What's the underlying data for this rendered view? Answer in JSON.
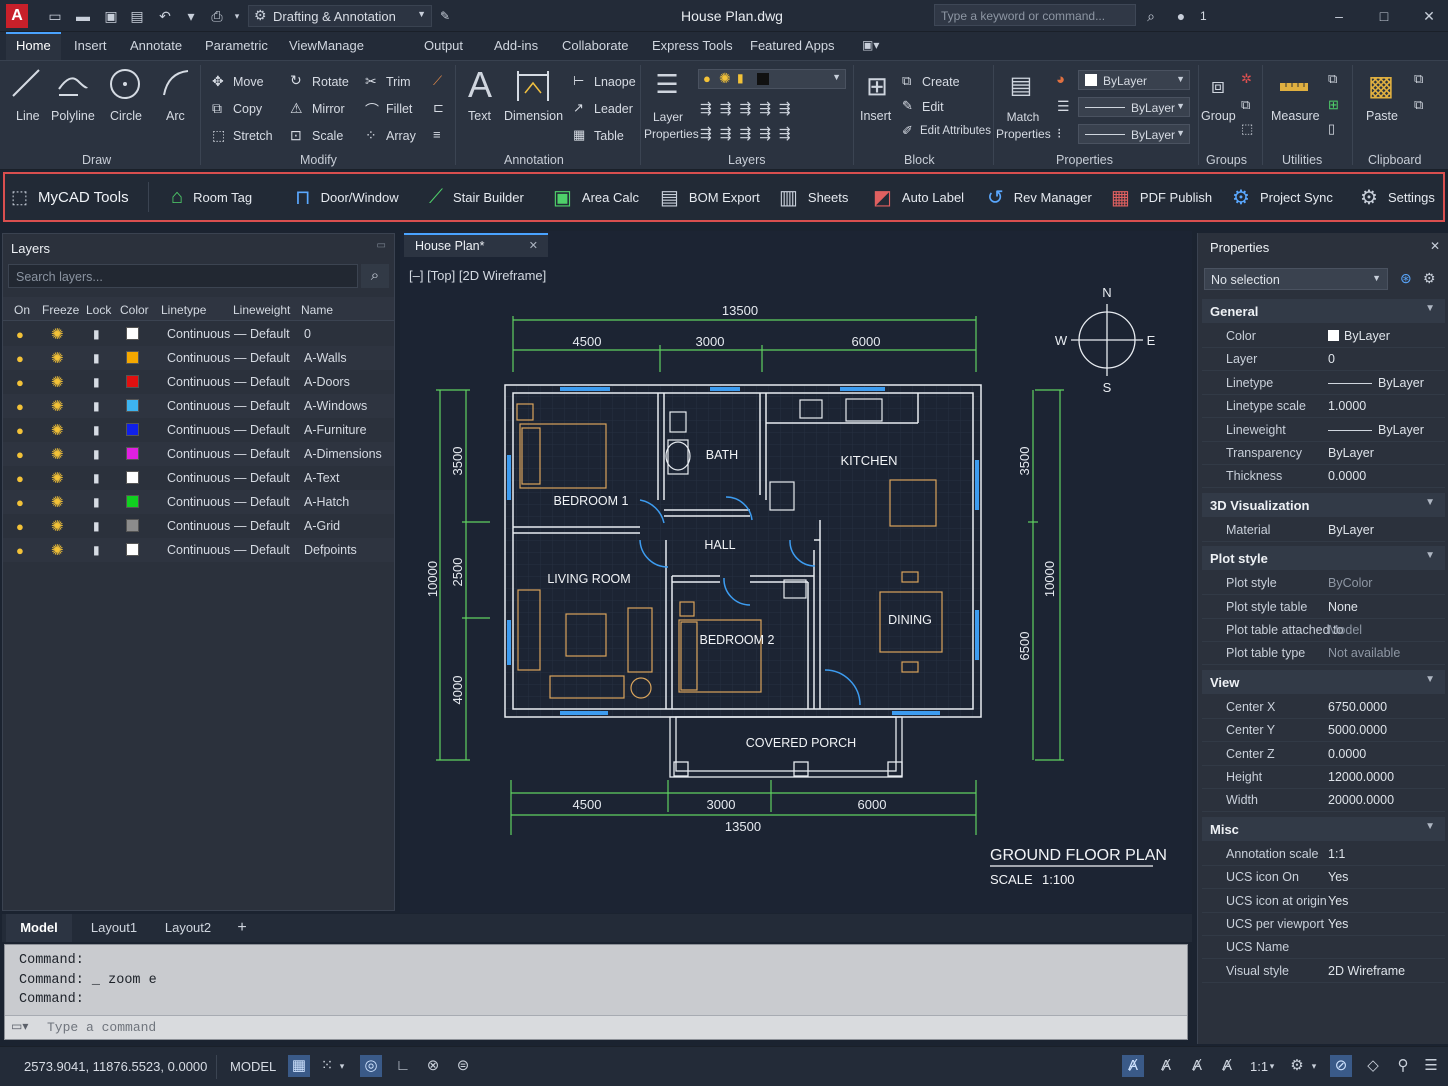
{
  "titlebar": {
    "workspace": "Drafting & Annotation",
    "title": "House Plan.dwg",
    "search_placeholder": "Type a keyword or command...",
    "user_count": "1"
  },
  "ribbon_tabs": [
    "Home",
    "Insert",
    "Annotate",
    "Parametric",
    "View",
    "Manage",
    "Output",
    "Add-ins",
    "Collaborate",
    "Express Tools",
    "Featured Apps"
  ],
  "ribbon": {
    "draw": {
      "line": "Line",
      "polyline": "Polyline",
      "circle": "Circle",
      "arc": "Arc",
      "label": "Draw"
    },
    "modify": {
      "move": "Move",
      "rotate": "Rotate",
      "trim": "Trim",
      "copy": "Copy",
      "mirror": "Mirror",
      "fillet": "Fillet",
      "stretch": "Stretch",
      "scale": "Scale",
      "array": "Array",
      "label": "Modify"
    },
    "annotation": {
      "text": "Text",
      "dimension": "Dimension",
      "linear": "Lnaope",
      "leader": "Leader",
      "table": "Table",
      "label": "Annotation"
    },
    "layers": {
      "layer_properties": "Layer Properties",
      "label": "Layers"
    },
    "block": {
      "insert": "Insert",
      "create": "Create",
      "edit": "Edit",
      "edit_attributes": "Edit Attributes",
      "label": "Block"
    },
    "properties": {
      "match": "Match Properties",
      "color": "ByLayer",
      "linetype": "ByLayer",
      "lineweight": "ByLayer",
      "label": "Properties"
    },
    "groups": {
      "group": "Group",
      "label": "Groups"
    },
    "utilities": {
      "measure": "Measure",
      "label": "Utilities"
    },
    "clipboard": {
      "paste": "Paste",
      "label": "Clipboard"
    }
  },
  "mycad": {
    "title": "MyCAD Tools",
    "tools": [
      "Room Tag",
      "Door/Window",
      "Stair Builder",
      "Area Calc",
      "BOM Export",
      "Sheets",
      "Auto Label",
      "Rev Manager",
      "PDF Publish",
      "Project Sync",
      "Settings"
    ]
  },
  "layers_panel": {
    "title": "Layers",
    "search_placeholder": "Search layers...",
    "columns": [
      "On",
      "Freeze",
      "Lock",
      "Color",
      "Linetype",
      "Lineweight",
      "Name"
    ],
    "rows": [
      {
        "color": "#ffffff",
        "linetype": "Continuous",
        "lineweight": "— Default",
        "name": "0"
      },
      {
        "color": "#f5a800",
        "linetype": "Continuous",
        "lineweight": "— Default",
        "name": "A-Walls"
      },
      {
        "color": "#e01010",
        "linetype": "Continuous",
        "lineweight": "— Default",
        "name": "A-Doors"
      },
      {
        "color": "#3db4f0",
        "linetype": "Continuous",
        "lineweight": "— Default",
        "name": "A-Windows"
      },
      {
        "color": "#1020e8",
        "linetype": "Continuous",
        "lineweight": "— Default",
        "name": "A-Furniture"
      },
      {
        "color": "#e020e0",
        "linetype": "Continuous",
        "lineweight": "— Default",
        "name": "A-Dimensions"
      },
      {
        "color": "#ffffff",
        "linetype": "Continuous",
        "lineweight": "— Default",
        "name": "A-Text"
      },
      {
        "color": "#10d020",
        "linetype": "Continuous",
        "lineweight": "— Default",
        "name": "A-Hatch"
      },
      {
        "color": "#8c8c8c",
        "linetype": "Continuous",
        "lineweight": "— Default",
        "name": "A-Grid"
      },
      {
        "color": "#ffffff",
        "linetype": "Continuous",
        "lineweight": "— Default",
        "name": "Defpoints"
      }
    ]
  },
  "drawing": {
    "tab": "House Plan*",
    "viewport_label": "[–] [Top] [2D Wireframe]",
    "dims_top": {
      "total": "13500",
      "a": "4500",
      "b": "3000",
      "c": "6000"
    },
    "dims_bottom": {
      "total": "13500",
      "a": "4500",
      "b": "3000",
      "c": "6000"
    },
    "dims_left": {
      "total": "10000",
      "a": "3500",
      "b": "2500",
      "c": "4000"
    },
    "dims_right": {
      "total": "10000",
      "a": "3500",
      "b": "6500"
    },
    "rooms": {
      "bedroom1": "BEDROOM 1",
      "bath": "BATH",
      "kitchen": "KITCHEN",
      "hall": "HALL",
      "living": "LIVING ROOM",
      "bedroom2": "BEDROOM 2",
      "dining": "DINING",
      "porch": "COVERED PORCH"
    },
    "compass": {
      "n": "N",
      "s": "S",
      "e": "E",
      "w": "W"
    },
    "plan_title": "GROUND FLOOR PLAN",
    "scale_label": "SCALE",
    "scale_value": "1:100"
  },
  "layout_tabs": [
    "Model",
    "Layout1",
    "Layout2"
  ],
  "command": {
    "history": [
      "Command:",
      "Command: _ zoom e",
      "Command:"
    ],
    "placeholder": "Type a command"
  },
  "properties": {
    "title": "Properties",
    "selection": "No selection",
    "sections": [
      {
        "name": "General",
        "rows": [
          [
            "Color",
            "ByLayer"
          ],
          [
            "Layer",
            "0"
          ],
          [
            "Linetype",
            "ByLayer"
          ],
          [
            "Linetype scale",
            "1.0000"
          ],
          [
            "Lineweight",
            "ByLayer"
          ],
          [
            "Transparency",
            "ByLayer"
          ],
          [
            "Thickness",
            "0.0000"
          ]
        ]
      },
      {
        "name": "3D Visualization",
        "rows": [
          [
            "Material",
            "ByLayer"
          ]
        ]
      },
      {
        "name": "Plot style",
        "rows": [
          [
            "Plot style",
            "ByColor"
          ],
          [
            "Plot style table",
            "None"
          ],
          [
            "Plot table attached to",
            "Model"
          ],
          [
            "Plot table type",
            "Not available"
          ]
        ]
      },
      {
        "name": "View",
        "rows": [
          [
            "Center X",
            "6750.0000"
          ],
          [
            "Center Y",
            "5000.0000"
          ],
          [
            "Center Z",
            "0.0000"
          ],
          [
            "Height",
            "12000.0000"
          ],
          [
            "Width",
            "20000.0000"
          ]
        ]
      },
      {
        "name": "Misc",
        "rows": [
          [
            "Annotation scale",
            "1:1"
          ],
          [
            "UCS icon On",
            "Yes"
          ],
          [
            "UCS icon at origin",
            "Yes"
          ],
          [
            "UCS per viewport",
            "Yes"
          ],
          [
            "UCS Name",
            ""
          ],
          [
            "Visual style",
            "2D Wireframe"
          ]
        ]
      }
    ]
  },
  "status": {
    "coords": "2573.9041, 11876.5523, 0.0000",
    "mode": "MODEL",
    "scale": "1:1"
  }
}
